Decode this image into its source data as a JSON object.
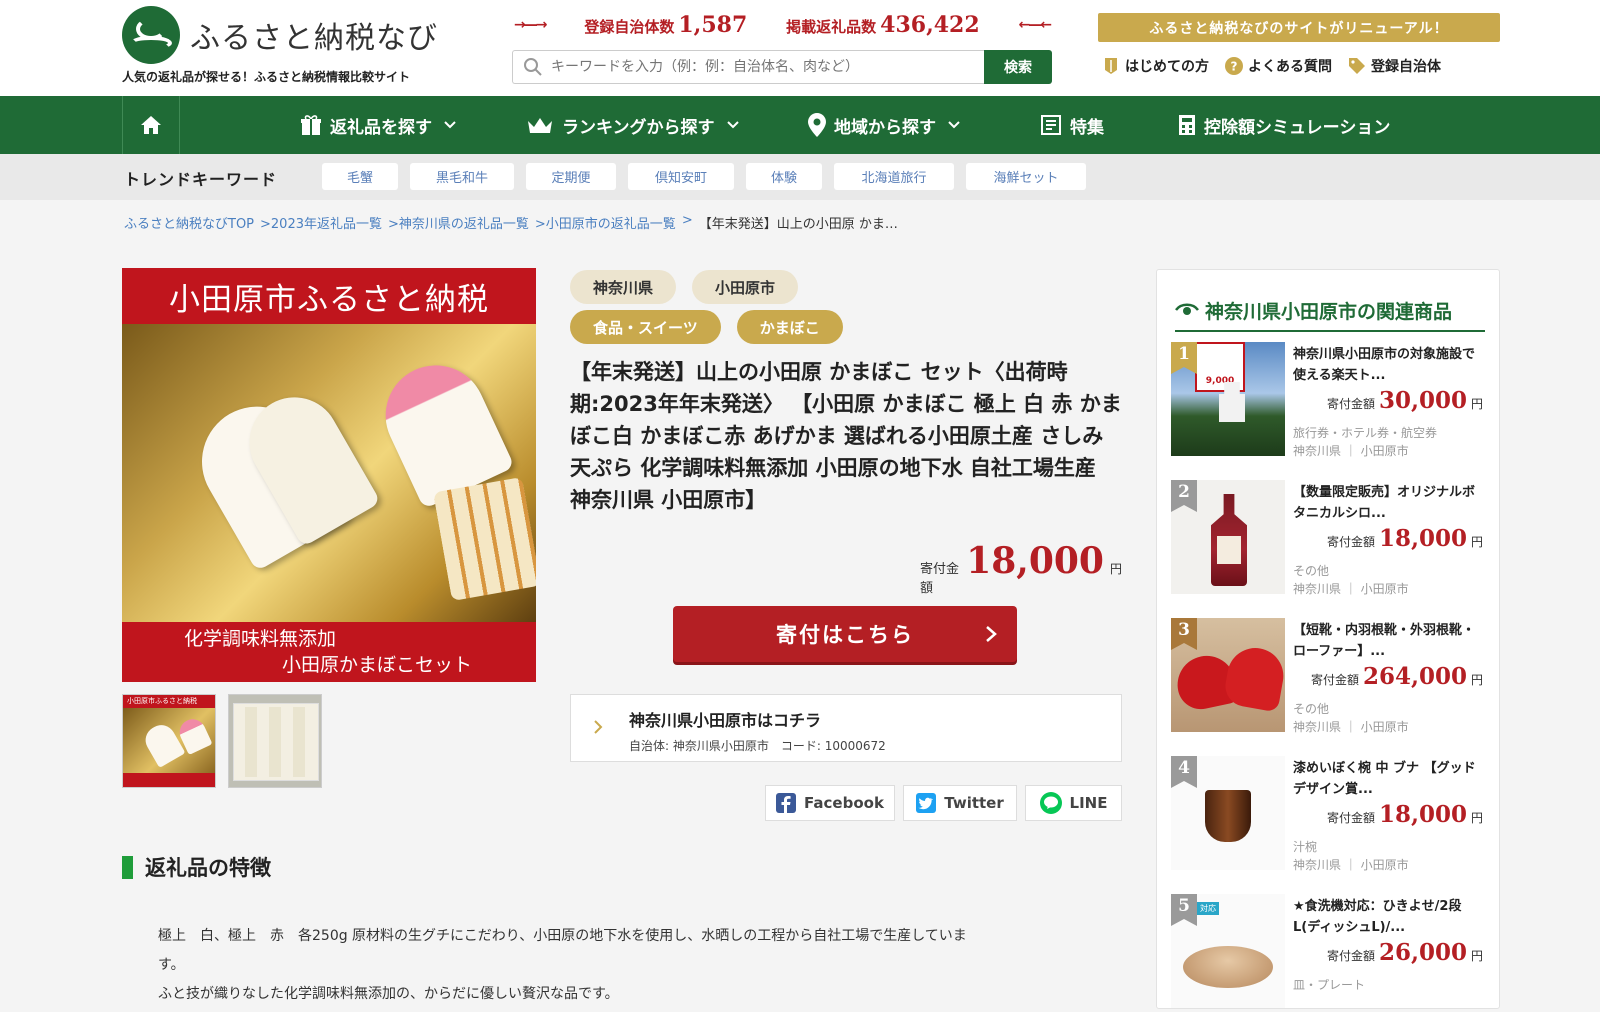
{
  "header": {
    "logo_title": "ふるさと納税なび",
    "logo_sub": "人気の返礼品が探せる！ふるさと納税情報比較サイト",
    "stats": [
      {
        "label": "登録自治体数",
        "value": "1,587"
      },
      {
        "label": "掲載返礼品数",
        "value": "436,422"
      }
    ],
    "search_placeholder": "キーワードを入力（例：例：自治体名、肉など）",
    "search_button": "検索",
    "renewal_banner": "ふるさと納税なびのサイトがリニューアル！",
    "links": [
      {
        "label": "はじめての方",
        "icon": "book-icon"
      },
      {
        "label": "よくある質問",
        "icon": "question-icon"
      },
      {
        "label": "登録自治体",
        "icon": "tag-icon"
      }
    ]
  },
  "nav": {
    "items": [
      {
        "label": "返礼品を探す",
        "icon": "gift-icon"
      },
      {
        "label": "ランキングから探す",
        "icon": "crown-icon"
      },
      {
        "label": "地域から探す",
        "icon": "pin-icon"
      },
      {
        "label": "特集",
        "icon": "article-icon"
      },
      {
        "label": "控除額シミュレーション",
        "icon": "calculator-icon"
      }
    ]
  },
  "trend": {
    "title": "トレンドキーワード",
    "keywords": [
      "毛蟹",
      "黒毛和牛",
      "定期便",
      "倶知安町",
      "体験",
      "北海道旅行",
      "海鮮セット"
    ]
  },
  "breadcrumb": [
    "ふるさと納税なびTOP",
    ">2023年返礼品一覧",
    ">神奈川県の返礼品一覧",
    ">小田原市の返礼品一覧",
    ">",
    "【年末発送】山上の小田原 かま…"
  ],
  "product": {
    "image_top": "小田原市ふるさと納税",
    "image_bottom_1": "化学調味料無添加",
    "image_bottom_2": "小田原かまぼこセット",
    "thumb_label": "小田原市ふるさと納税",
    "tags_pref": [
      "神奈川県",
      "小田原市"
    ],
    "tags_cat": [
      "食品・スイーツ",
      "かまぼこ"
    ],
    "title": "【年末発送】山上の小田原 かまぼこ セット〈出荷時期:2023年年末発送〉 【小田原 かまぼこ 極上 白 赤 かまぼこ白 かまぼこ赤 あげかま 選ばれる小田原土産 さしみ天ぷら 化学調味料無添加 小田原の地下水 自社工場生産 神奈川県 小田原市】",
    "price_label": "寄付金額",
    "price": "18,000",
    "price_unit": "円",
    "donate_button": "寄付はこちら",
    "muni_title": "神奈川県小田原市はコチラ",
    "muni_sub": "自治体: 神奈川県小田原市　コード: 10000672",
    "share": [
      "Facebook",
      "Twitter",
      "LINE"
    ]
  },
  "features": {
    "title": "返礼品の特徴",
    "text_1": "極上　白、極上　赤　各250g 原材料の生グチにこだわり、小田原の地下水を使用し、水晒しの工程から自社工場で生産していま",
    "text_2": "す。",
    "text_3": "ふと技が織りなした化学調味料無添加の、からだに優しい贅沢な品です。"
  },
  "sidebar": {
    "title": "神奈川県小田原市の関連商品",
    "items": [
      {
        "rank": "1",
        "name": "神奈川県小田原市の対象施設で使える楽天ト...",
        "price_label": "寄付金額",
        "price": "30,000",
        "unit": "円",
        "category": "旅行券・ホテル券・航空券",
        "location": "神奈川県 ｜ 小田原市",
        "badge": "9,000"
      },
      {
        "rank": "2",
        "name": "【数量限定販売】オリジナルボタニカルシロ...",
        "price_label": "寄付金額",
        "price": "18,000",
        "unit": "円",
        "category": "その他",
        "location": "神奈川県 ｜ 小田原市"
      },
      {
        "rank": "3",
        "name": "【短靴・内羽根靴・外羽根靴・ローファー】...",
        "price_label": "寄付金額",
        "price": "264,000",
        "unit": "円",
        "category": "その他",
        "location": "神奈川県 ｜ 小田原市"
      },
      {
        "rank": "4",
        "name": "漆めいぼく椀 中 ブナ 【グッドデザイン賞...",
        "price_label": "寄付金額",
        "price": "18,000",
        "unit": "円",
        "category": "汁椀",
        "location": "神奈川県 ｜ 小田原市"
      },
      {
        "rank": "5",
        "name": "★食洗機対応：ひきよせ/2段L(ディッシュL)/...",
        "price_label": "寄付金額",
        "price": "26,000",
        "unit": "円",
        "category": "皿・プレート",
        "location": "",
        "badge": "対応"
      }
    ]
  },
  "colors": {
    "brand_green": "#1f6b36",
    "accent_red": "#b41f24",
    "gold": "#c9a94d"
  }
}
